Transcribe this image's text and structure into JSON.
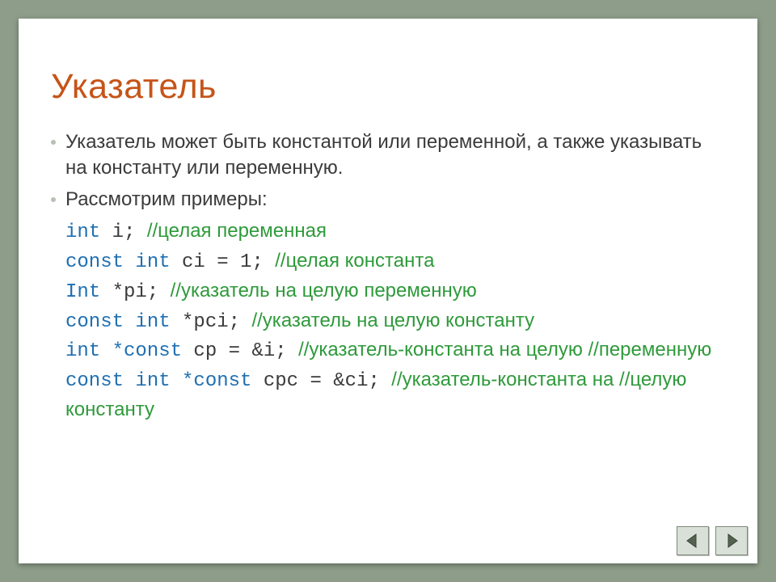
{
  "title": "Указатель",
  "bullets": [
    "Указатель может быть константой или переменной, а также указывать на константу или переменную.",
    "Рассмотрим примеры:"
  ],
  "code": {
    "l1": {
      "kw": "int",
      "id": " i",
      "sep": "; ",
      "cmt": "//целая переменная"
    },
    "l2": {
      "kw": "const int",
      "id": " ci = 1",
      "sep": "; ",
      "cmt": "//целая константа"
    },
    "l3": {
      "kw": "Int",
      "id": " *pi",
      "sep": "; ",
      "cmt": "//указатель на целую переменную"
    },
    "l4": {
      "kw": "const int",
      "id": " *pci",
      "sep": "; ",
      "cmt": "//указатель на целую константу"
    },
    "l5": {
      "kw1": "int ",
      "kw2": "*const",
      "id": " cp = &i",
      "sep": "; ",
      "cmt": "//указатель-константа на целую //переменную"
    },
    "l6": {
      "kw1": "const int ",
      "kw2": "*const",
      "id": " cpc = &ci",
      "sep": "; ",
      "cmt": "//указатель-константа на //целую константу"
    }
  },
  "nav": {
    "prev": "previous-slide",
    "next": "next-slide"
  }
}
